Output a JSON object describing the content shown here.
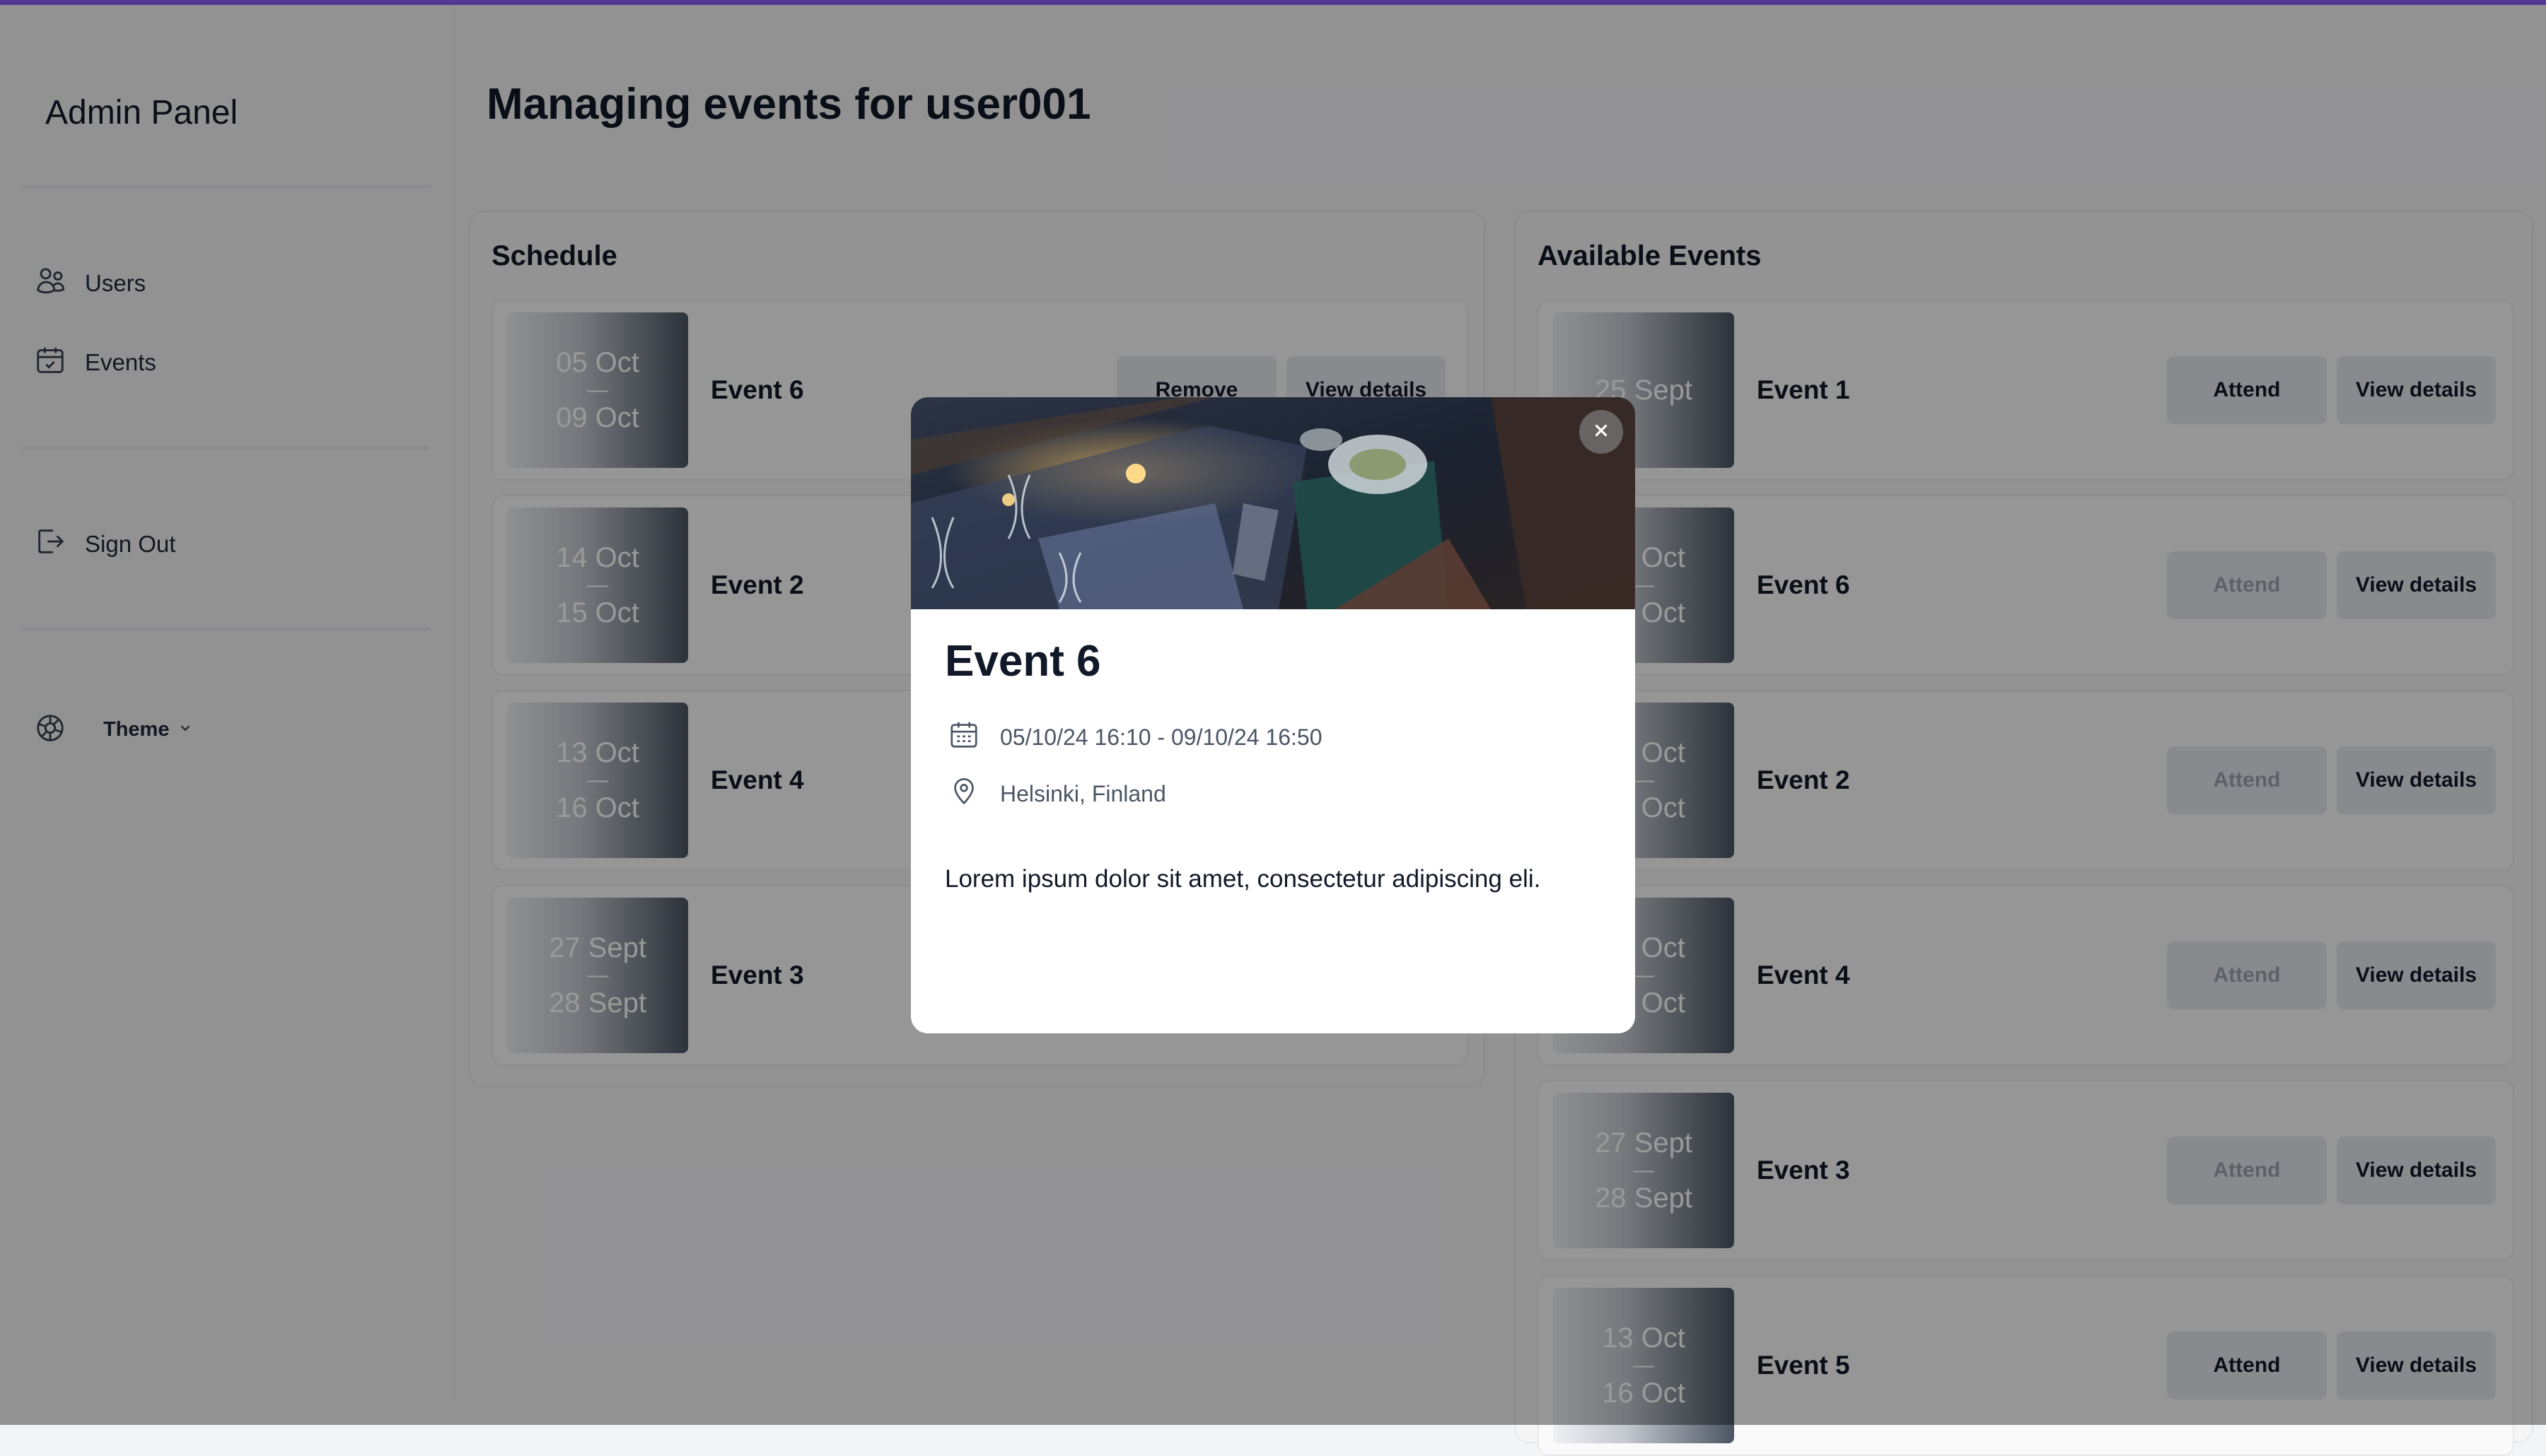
{
  "sidebar": {
    "brand": "Admin Panel",
    "nav": [
      {
        "label": "Users",
        "icon": "users-icon"
      },
      {
        "label": "Events",
        "icon": "calendar-check-icon"
      }
    ],
    "sign_out": {
      "label": "Sign Out",
      "icon": "sign-out-icon"
    },
    "theme": {
      "label": "Theme",
      "icon": "palette-icon"
    }
  },
  "header": {
    "title": "Managing events for user001"
  },
  "schedule": {
    "title": "Schedule",
    "remove_label": "Remove",
    "details_label": "View details",
    "items": [
      {
        "start": "05 Oct",
        "end": "09 Oct",
        "name": "Event 6"
      },
      {
        "start": "14 Oct",
        "end": "15 Oct",
        "name": "Event 2"
      },
      {
        "start": "13 Oct",
        "end": "16 Oct",
        "name": "Event 4"
      },
      {
        "start": "27 Sept",
        "end": "28 Sept",
        "name": "Event 3"
      }
    ]
  },
  "available": {
    "title": "Available Events",
    "attend_label": "Attend",
    "details_label": "View details",
    "items": [
      {
        "start": "25 Sept",
        "end": "",
        "name": "Event 1",
        "attend_enabled": true
      },
      {
        "start": "05 Oct",
        "end": "09 Oct",
        "name": "Event 6",
        "attend_enabled": false
      },
      {
        "start": "14 Oct",
        "end": "15 Oct",
        "name": "Event 2",
        "attend_enabled": false
      },
      {
        "start": "13 Oct",
        "end": "16 Oct",
        "name": "Event 4",
        "attend_enabled": false
      },
      {
        "start": "27 Sept",
        "end": "28 Sept",
        "name": "Event 3",
        "attend_enabled": false
      },
      {
        "start": "13 Oct",
        "end": "16 Oct",
        "name": "Event 5",
        "attend_enabled": true
      }
    ]
  },
  "modal": {
    "title": "Event 6",
    "datetime": "05/10/24 16:10 - 09/10/24 16:50",
    "location": "Helsinki, Finland",
    "description": "Lorem ipsum dolor sit amet, consectetur adipiscing eli."
  },
  "colors": {
    "accent": "#8b5cf6",
    "overlay": "rgba(0,0,0,0.40)"
  }
}
